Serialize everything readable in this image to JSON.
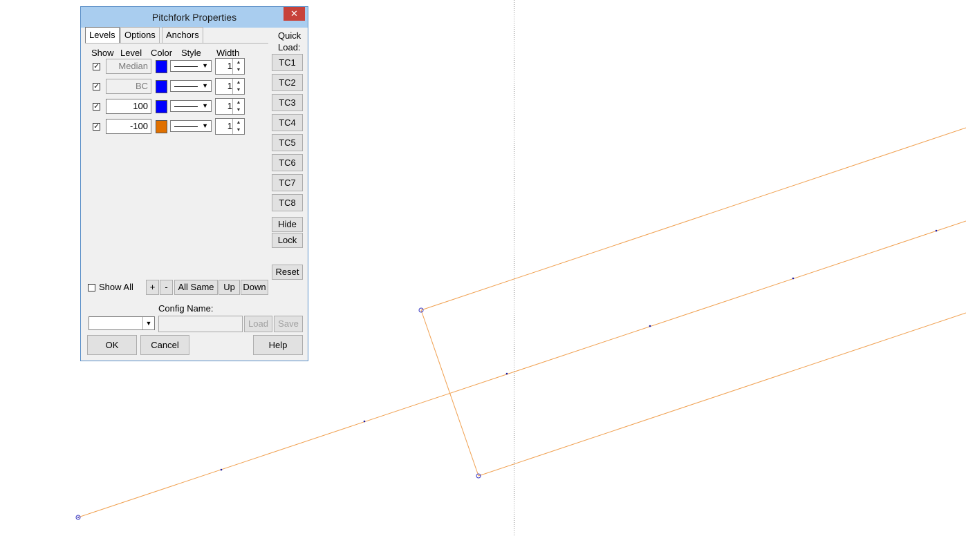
{
  "dialog": {
    "title": "Pitchfork Properties",
    "close_glyph": "✕",
    "tabs": [
      {
        "label": "Levels",
        "active": true
      },
      {
        "label": "Options",
        "active": false
      },
      {
        "label": "Anchors",
        "active": false
      }
    ],
    "headers": {
      "show": "Show",
      "level": "Level",
      "color": "Color",
      "style": "Style",
      "width": "Width"
    },
    "levels": [
      {
        "checked": true,
        "level": "Median",
        "editable": false,
        "color": "#0000ff",
        "width": "1"
      },
      {
        "checked": true,
        "level": "BC",
        "editable": false,
        "color": "#0000ff",
        "width": "1"
      },
      {
        "checked": true,
        "level": "100",
        "editable": true,
        "color": "#0000ff",
        "width": "1"
      },
      {
        "checked": true,
        "level": "-100",
        "editable": true,
        "color": "#e07000",
        "width": "1"
      }
    ],
    "quick_load_label_1": "Quick",
    "quick_load_label_2": "Load:",
    "quick_buttons": [
      "TC1",
      "TC2",
      "TC3",
      "TC4",
      "TC5",
      "TC6",
      "TC7",
      "TC8"
    ],
    "hide_label": "Hide",
    "lock_label": "Lock",
    "reset_label": "Reset",
    "show_all_label": "Show All",
    "show_all_checked": false,
    "plus_label": "+",
    "minus_label": "-",
    "all_same_label": "All Same",
    "up_label": "Up",
    "down_label": "Down",
    "config_name_label": "Config Name:",
    "config_value": "",
    "config_name_value": "",
    "load_label": "Load",
    "save_label": "Save",
    "ok_label": "OK",
    "cancel_label": "Cancel",
    "help_label": "Help"
  },
  "chart_colors": {
    "pitchfork_line": "#f0a050",
    "anchor_marker": "#3030c0",
    "dot_marker": "#1a1aa0",
    "vertical_cursor": "#888888"
  }
}
